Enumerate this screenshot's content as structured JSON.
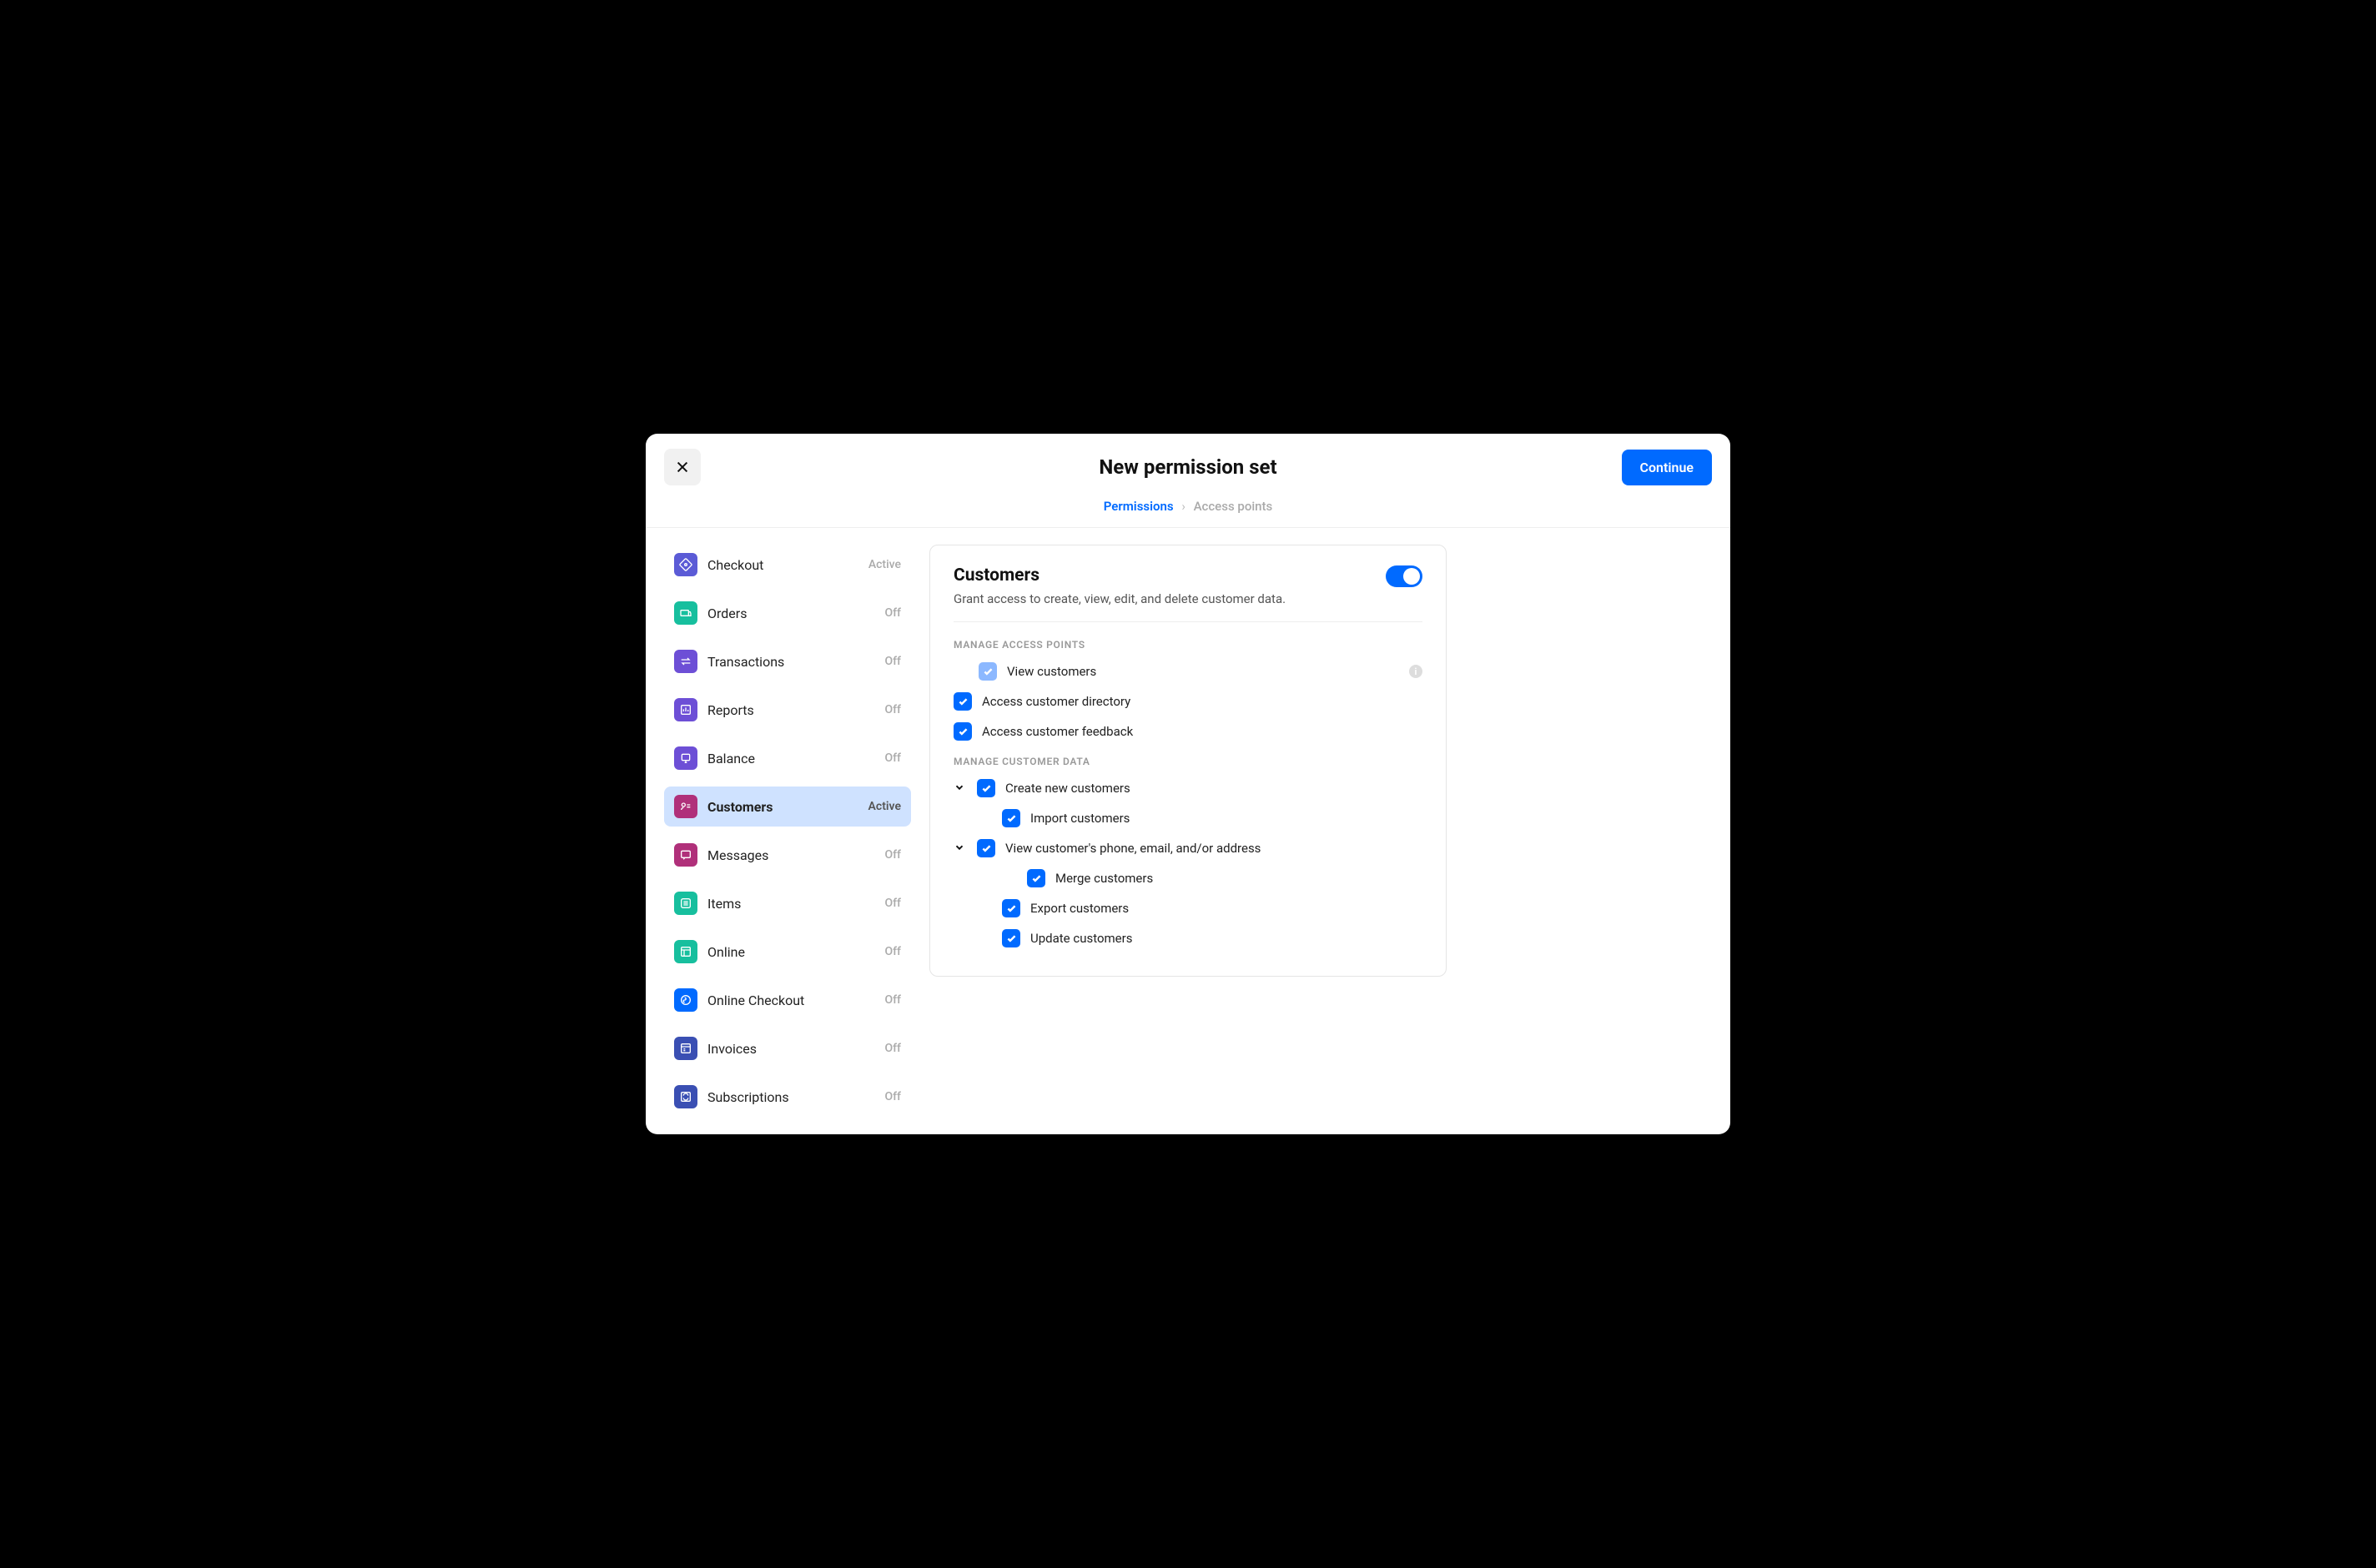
{
  "header": {
    "title": "New permission set",
    "continue_label": "Continue"
  },
  "breadcrumb": {
    "active": "Permissions",
    "inactive": "Access points"
  },
  "sidebar": {
    "items": [
      {
        "label": "Checkout",
        "status": "Active",
        "color": "#5b5bd6",
        "selected": false
      },
      {
        "label": "Orders",
        "status": "Off",
        "color": "#17bf9e",
        "selected": false
      },
      {
        "label": "Transactions",
        "status": "Off",
        "color": "#6d4fd6",
        "selected": false
      },
      {
        "label": "Reports",
        "status": "Off",
        "color": "#6d4fd6",
        "selected": false
      },
      {
        "label": "Balance",
        "status": "Off",
        "color": "#6d4fd6",
        "selected": false
      },
      {
        "label": "Customers",
        "status": "Active",
        "color": "#b0307a",
        "selected": true
      },
      {
        "label": "Messages",
        "status": "Off",
        "color": "#b0307a",
        "selected": false
      },
      {
        "label": "Items",
        "status": "Off",
        "color": "#17bf9e",
        "selected": false
      },
      {
        "label": "Online",
        "status": "Off",
        "color": "#17bf9e",
        "selected": false
      },
      {
        "label": "Online Checkout",
        "status": "Off",
        "color": "#006aff",
        "selected": false
      },
      {
        "label": "Invoices",
        "status": "Off",
        "color": "#3a4fb3",
        "selected": false
      },
      {
        "label": "Subscriptions",
        "status": "Off",
        "color": "#3a4fb3",
        "selected": false
      }
    ]
  },
  "detail": {
    "title": "Customers",
    "description": "Grant access to create, view, edit, and delete customer data.",
    "toggle_on": true,
    "sections": {
      "access_points": {
        "label": "MANAGE ACCESS POINTS",
        "items": [
          {
            "label": "View customers",
            "checked": true,
            "disabled": true,
            "info": true
          },
          {
            "label": "Access customer directory",
            "checked": true,
            "disabled": false
          },
          {
            "label": "Access customer feedback",
            "checked": true,
            "disabled": false
          }
        ]
      },
      "customer_data": {
        "label": "MANAGE CUSTOMER DATA",
        "items": [
          {
            "label": "Create new customers",
            "checked": true,
            "chevron": true
          },
          {
            "label": "Import customers",
            "checked": true,
            "indent": true
          },
          {
            "label": "View customer's phone, email, and/or address",
            "checked": true,
            "chevron": true
          },
          {
            "label": "Merge customers",
            "checked": true,
            "indent": true
          },
          {
            "label": "Export customers",
            "checked": true
          },
          {
            "label": "Update customers",
            "checked": true
          }
        ]
      }
    }
  }
}
